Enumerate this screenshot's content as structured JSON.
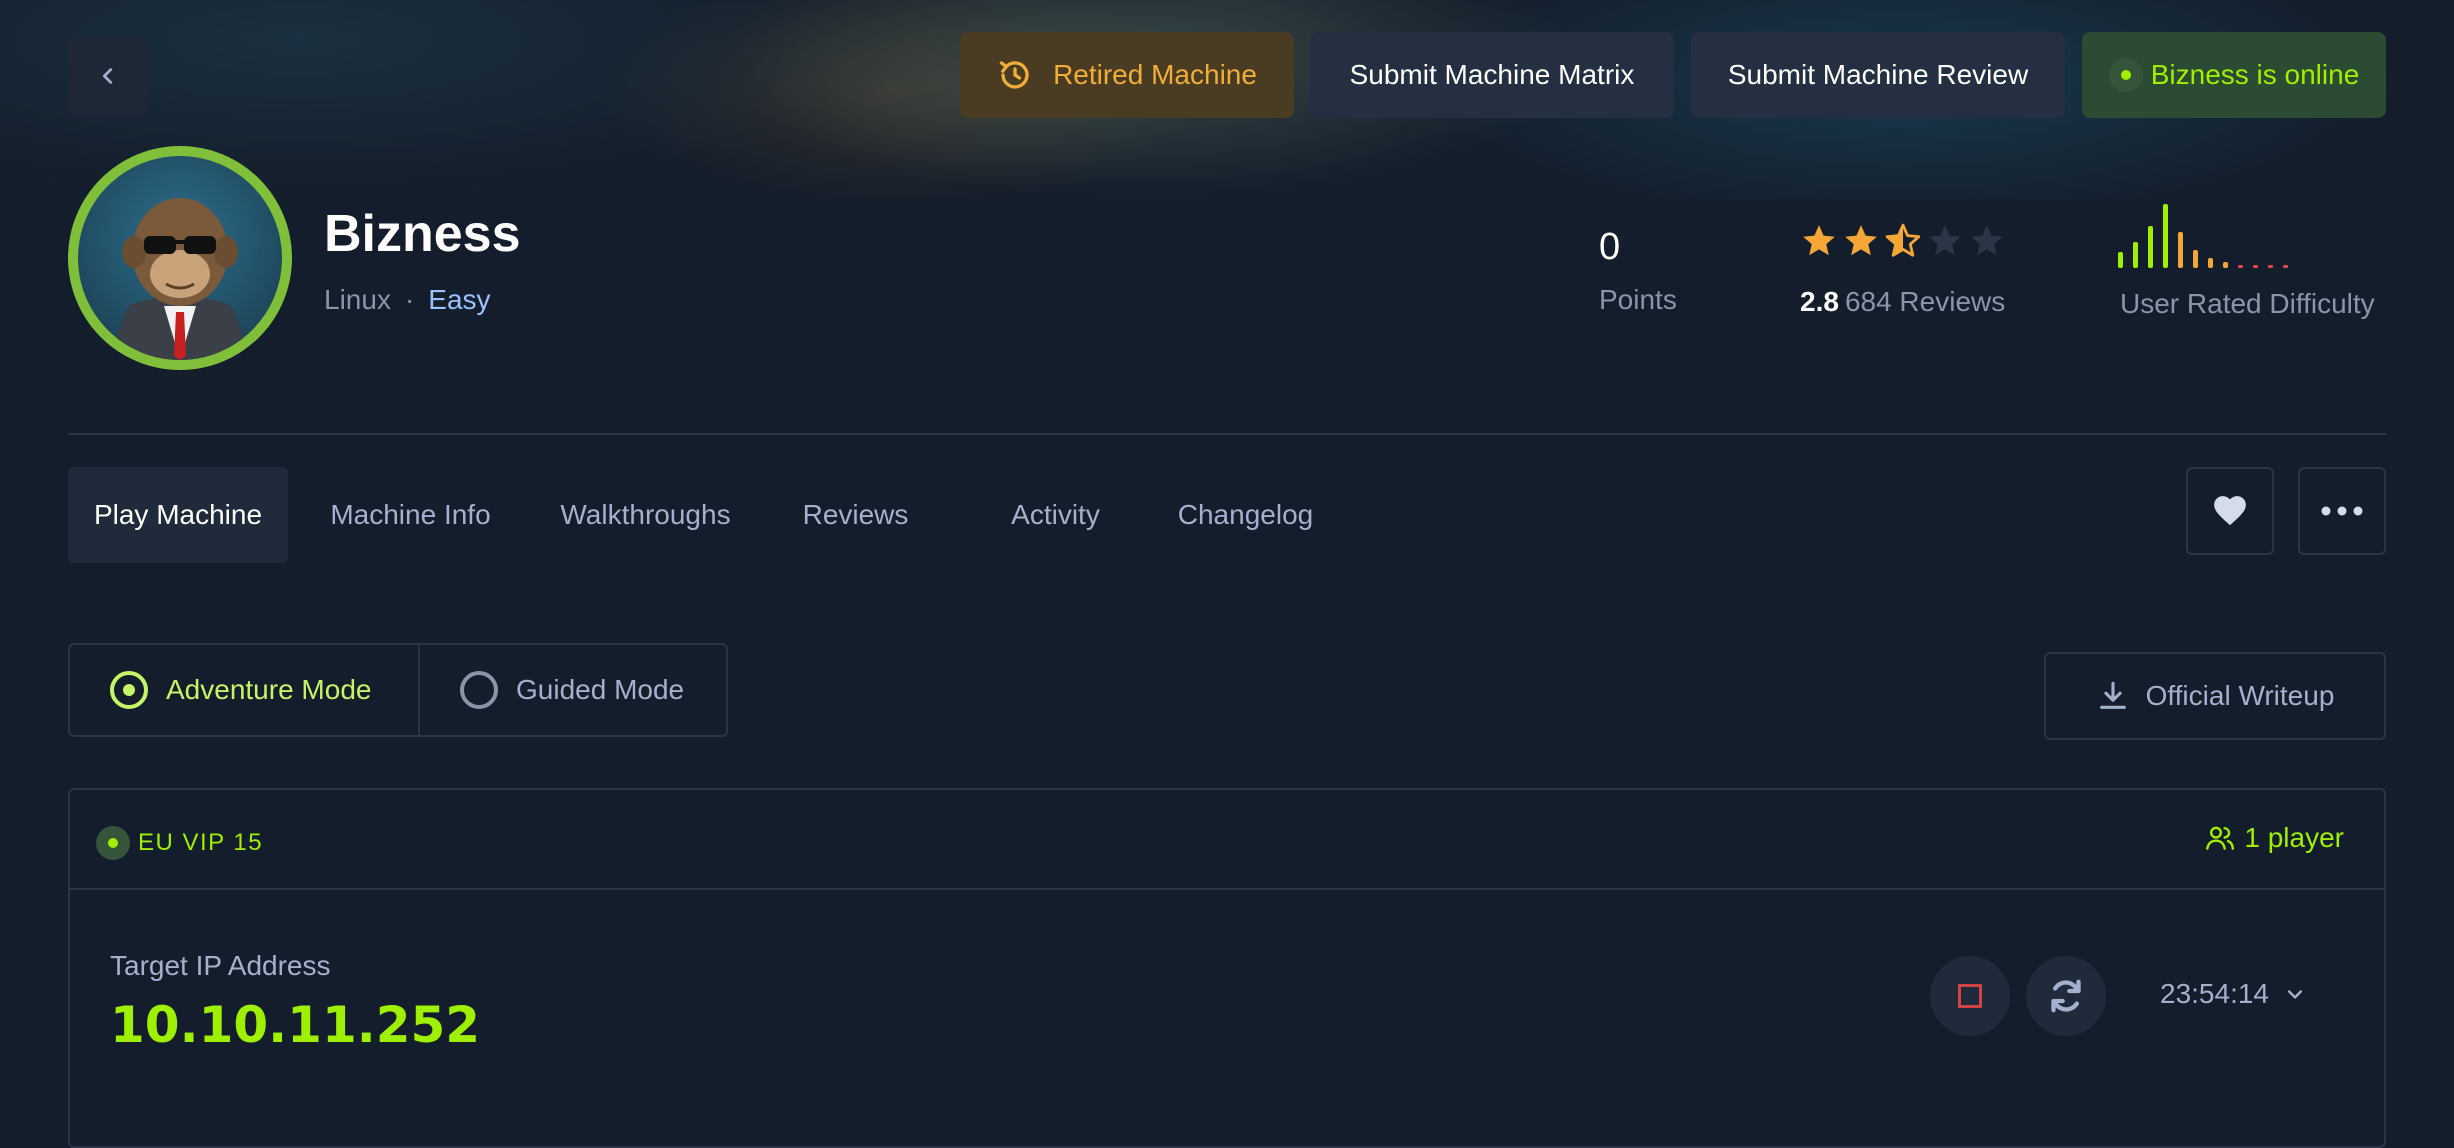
{
  "header": {
    "retired_label": "Retired Machine",
    "submit_matrix_label": "Submit Machine Matrix",
    "submit_review_label": "Submit Machine Review",
    "online_status": "Bizness is online"
  },
  "machine": {
    "name": "Bizness",
    "os": "Linux",
    "separator": "·",
    "difficulty": "Easy"
  },
  "stats": {
    "points_value": "0",
    "points_label": "Points",
    "rating_value": "2.8",
    "reviews_text": "684 Reviews",
    "stars": 2.5,
    "difficulty_label": "User Rated Difficulty"
  },
  "tabs": [
    {
      "label": "Play Machine",
      "active": true
    },
    {
      "label": "Machine Info"
    },
    {
      "label": "Walkthroughs"
    },
    {
      "label": "Reviews"
    },
    {
      "label": "Activity"
    },
    {
      "label": "Changelog"
    }
  ],
  "modes": {
    "adventure": "Adventure Mode",
    "guided": "Guided Mode",
    "selected": "Adventure Mode"
  },
  "writeup_label": "Official Writeup",
  "instance": {
    "server": "EU VIP 15",
    "players": "1 player",
    "ip_label": "Target IP Address",
    "ip_value": "10.10.11.252",
    "timer": "23:54:14"
  },
  "colors": {
    "background": "#141d2b",
    "accent_green": "#9fef00",
    "retired_orange": "#f0ae39",
    "star_orange": "#f4a636",
    "stop_red": "#e04545"
  },
  "icons": [
    "chevron-left-icon",
    "history-icon",
    "star-icon",
    "heart-icon",
    "more-icon",
    "download-icon",
    "user-group-icon",
    "stop-icon",
    "refresh-icon",
    "chevron-down-icon"
  ]
}
